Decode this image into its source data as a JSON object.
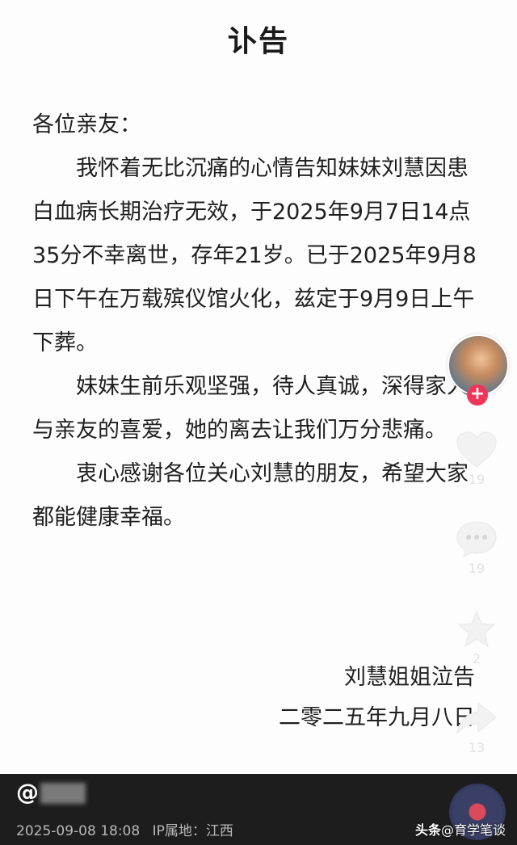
{
  "notice": {
    "title": "讣告",
    "salutation": "各位亲友：",
    "paragraphs": [
      "我怀着无比沉痛的心情告知妹妹刘慧因患白血病长期治疗无效，于2025年9月7日14点35分不幸离世，存年21岁。已于2025年9月8日下午在万载殡仪馆火化，兹定于9月9日上午下葬。",
      "妹妹生前乐观坚强，待人真诚，深得家人与亲友的喜爱，她的离去让我们万分悲痛。",
      "衷心感谢各位关心刘慧的朋友，希望大家都能健康幸福。"
    ],
    "signature": "刘慧姐姐泣告",
    "date": "二零二五年九月八日"
  },
  "rail": {
    "follow_symbol": "+",
    "like_count": "19",
    "comment_count": "19",
    "favorite_count": "2",
    "share_count": "13",
    "icons": {
      "like": "heart-icon",
      "comment": "comment-bubble-icon",
      "favorite": "star-icon",
      "share": "share-arrow-icon"
    }
  },
  "footer": {
    "author_prefix": "@",
    "timestamp": "2025-09-08 18:08",
    "ip_label": "IP属地：江西",
    "watermark_brand": "头条",
    "watermark_account": "@育学笔谈"
  },
  "colors": {
    "follow_accent": "#f0355a",
    "bottom_bar": "#1d1d1d"
  }
}
